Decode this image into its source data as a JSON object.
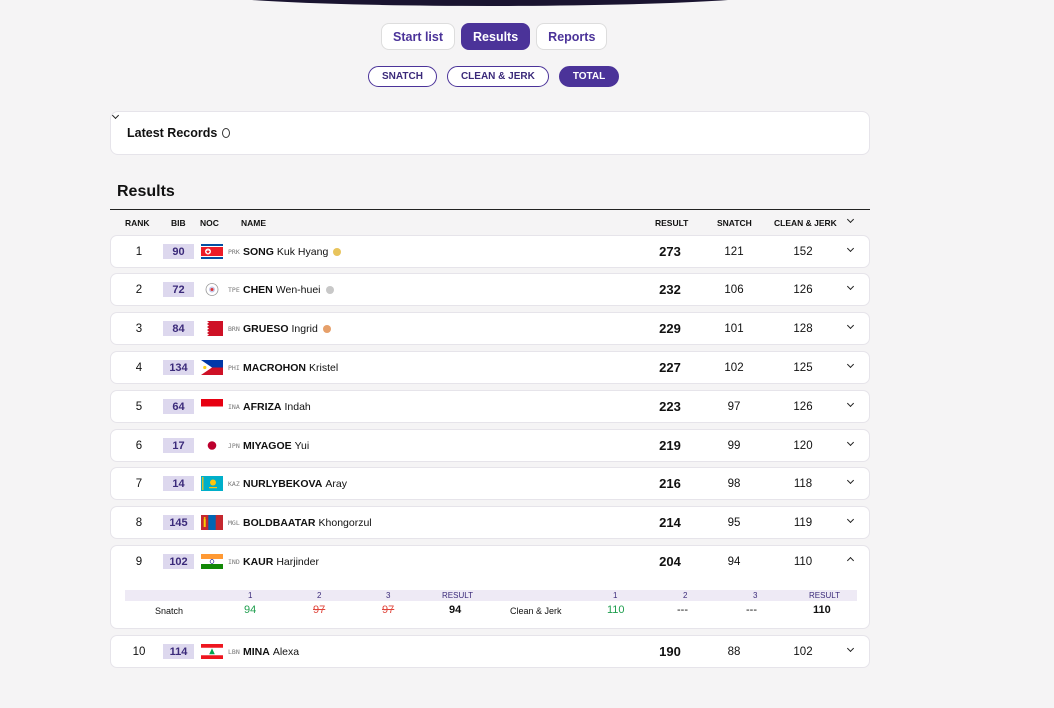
{
  "tabs": [
    {
      "label": "Start list",
      "active": false
    },
    {
      "label": "Results",
      "active": true
    },
    {
      "label": "Reports",
      "active": false
    }
  ],
  "filters": [
    {
      "label": "SNATCH",
      "active": false
    },
    {
      "label": "CLEAN & JERK",
      "active": false
    },
    {
      "label": "TOTAL",
      "active": true
    }
  ],
  "records": {
    "label": "Latest Records",
    "icon": "medal-icon"
  },
  "results_title": "Results",
  "columns": {
    "rank": "RANK",
    "bib": "BIB",
    "noc": "NOC",
    "name": "NAME",
    "result": "RESULT",
    "snatch": "SNATCH",
    "cj": "CLEAN & JERK"
  },
  "colors": {
    "accent": "#4b3399",
    "gold": "#e8c45c",
    "silver": "#c8c8c8",
    "bronze": "#e6a06a",
    "good_lift": "#1f9e4e",
    "no_lift": "#e0443a"
  },
  "rows": [
    {
      "rank": "1",
      "bib": "90",
      "noc": "PRK",
      "last": "SONG",
      "first": "Kuk Hyang",
      "medal": "gold",
      "result": "273",
      "snatch": "121",
      "cj": "152"
    },
    {
      "rank": "2",
      "bib": "72",
      "noc": "TPE",
      "last": "CHEN",
      "first": "Wen-huei",
      "medal": "silver",
      "result": "232",
      "snatch": "106",
      "cj": "126"
    },
    {
      "rank": "3",
      "bib": "84",
      "noc": "BRN",
      "last": "GRUESO",
      "first": "Ingrid",
      "medal": "bronze",
      "result": "229",
      "snatch": "101",
      "cj": "128"
    },
    {
      "rank": "4",
      "bib": "134",
      "noc": "PHI",
      "last": "MACROHON",
      "first": "Kristel",
      "medal": "",
      "result": "227",
      "snatch": "102",
      "cj": "125"
    },
    {
      "rank": "5",
      "bib": "64",
      "noc": "INA",
      "last": "AFRIZA",
      "first": "Indah",
      "medal": "",
      "result": "223",
      "snatch": "97",
      "cj": "126"
    },
    {
      "rank": "6",
      "bib": "17",
      "noc": "JPN",
      "last": "MIYAGOE",
      "first": "Yui",
      "medal": "",
      "result": "219",
      "snatch": "99",
      "cj": "120"
    },
    {
      "rank": "7",
      "bib": "14",
      "noc": "KAZ",
      "last": "NURLYBEKOVA",
      "first": "Aray",
      "medal": "",
      "result": "216",
      "snatch": "98",
      "cj": "118"
    },
    {
      "rank": "8",
      "bib": "145",
      "noc": "MGL",
      "last": "BOLDBAATAR",
      "first": "Khongorzul",
      "medal": "",
      "result": "214",
      "snatch": "95",
      "cj": "119"
    },
    {
      "rank": "9",
      "bib": "102",
      "noc": "IND",
      "last": "KAUR",
      "first": "Harjinder",
      "medal": "",
      "result": "204",
      "snatch": "94",
      "cj": "110"
    },
    {
      "rank": "10",
      "bib": "114",
      "noc": "LBN",
      "last": "MINA",
      "first": "Alexa",
      "medal": "",
      "result": "190",
      "snatch": "88",
      "cj": "102"
    }
  ],
  "expanded_detail": {
    "headers": [
      "1",
      "2",
      "3",
      "RESULT"
    ],
    "snatch_label": "Snatch",
    "snatch_attempts": [
      "94",
      "97",
      "97"
    ],
    "snatch_result": "94",
    "cj_label": "Clean & Jerk",
    "cj_attempts": [
      "110",
      "---",
      "---"
    ],
    "cj_result": "110"
  }
}
